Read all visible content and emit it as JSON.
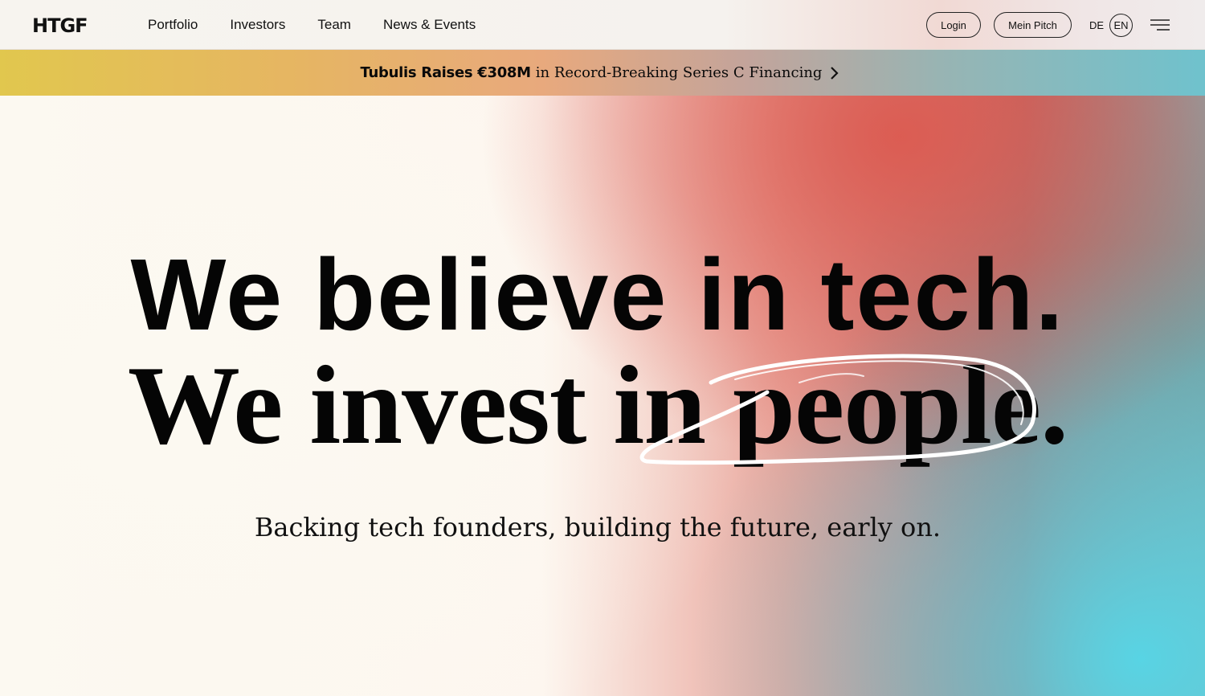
{
  "header": {
    "logo": "HTGF",
    "nav": [
      "Portfolio",
      "Investors",
      "Team",
      "News & Events"
    ],
    "login_label": "Login",
    "pitch_label": "Mein Pitch",
    "lang_de": "DE",
    "lang_en": "EN",
    "menu_icon": "hamburger-icon"
  },
  "announcement": {
    "bold": "Tubulis Raises €308M",
    "rest": "in Record-Breaking Series C Financing",
    "icon": "chevron-right-icon"
  },
  "hero": {
    "title": "We believe in tech.",
    "subtitle": "We invest in people.",
    "tagline": "Backing tech founders, building the future, early on."
  },
  "colors": {
    "text": "#050505",
    "banner_start": "#e1c74e",
    "banner_end": "#6fc2cd",
    "accent_red": "#dc5a50",
    "accent_cyan": "#58d4e4"
  }
}
